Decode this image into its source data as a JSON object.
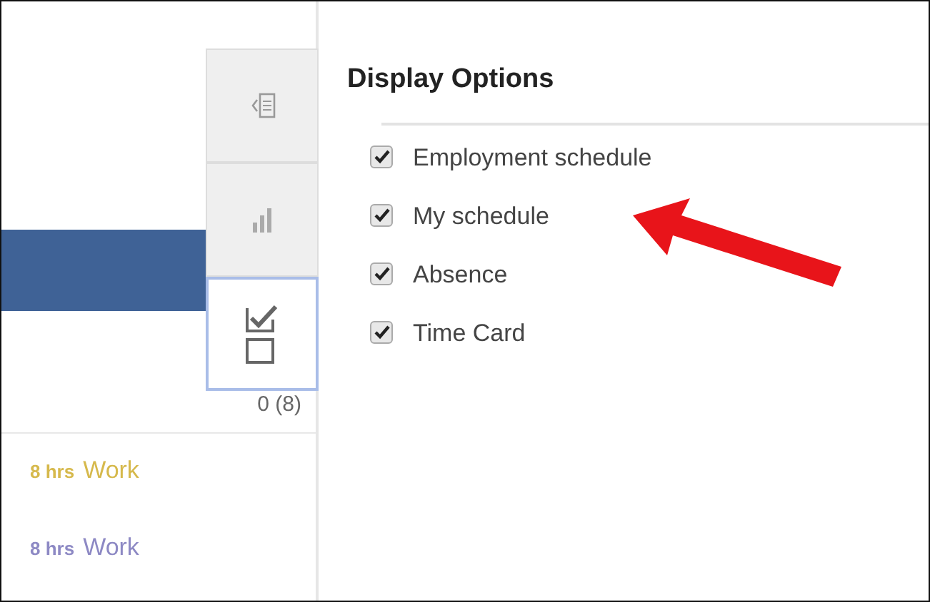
{
  "side_tabs": [
    {
      "kind": "panel",
      "selected": false
    },
    {
      "kind": "chart",
      "selected": false
    },
    {
      "kind": "options",
      "selected": true
    }
  ],
  "count": "0 (8)",
  "entries": [
    {
      "hours": "8 hrs",
      "label": "Work",
      "color": "#d6b94c"
    },
    {
      "hours": "8 hrs",
      "label": "Work",
      "color": "#8d89c4"
    }
  ],
  "display_options": {
    "title": "Display Options",
    "items": [
      {
        "label": "Employment schedule",
        "checked": true
      },
      {
        "label": "My schedule",
        "checked": true
      },
      {
        "label": "Absence",
        "checked": true
      },
      {
        "label": "Time Card",
        "checked": true
      }
    ]
  }
}
